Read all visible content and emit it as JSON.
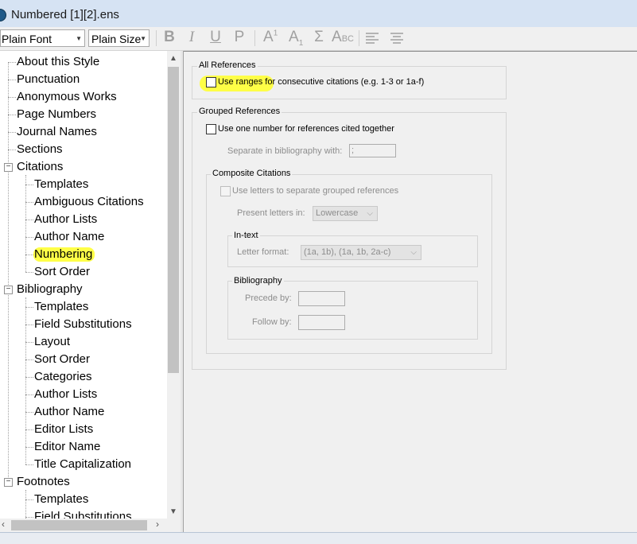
{
  "window": {
    "title": "Numbered [1][2].ens"
  },
  "toolbar": {
    "font": "Plain Font",
    "size": "Plain Size",
    "format_buttons": [
      "B",
      "I",
      "U",
      "P"
    ],
    "script_buttons": [
      "A",
      "A",
      "Σ",
      "A"
    ]
  },
  "tree": {
    "items": [
      "About this Style",
      "Punctuation",
      "Anonymous Works",
      "Page Numbers",
      "Journal Names",
      "Sections",
      "Citations",
      "Templates",
      "Ambiguous Citations",
      "Author Lists",
      "Author Name",
      "Numbering",
      "Sort Order",
      "Bibliography",
      "Templates",
      "Field Substitutions",
      "Layout",
      "Sort Order",
      "Categories",
      "Author Lists",
      "Author Name",
      "Editor Lists",
      "Editor Name",
      "Title Capitalization",
      "Footnotes",
      "Templates",
      "Field Substitutions"
    ],
    "selected": "Numbering"
  },
  "panel": {
    "all_refs": {
      "title": "All References",
      "use_ranges": "Use ranges for consecutive citations (e.g. 1-3 or 1a-f)"
    },
    "grouped": {
      "title": "Grouped References",
      "use_one_number": "Use one number for references cited together",
      "separate_label": "Separate in bibliography with:",
      "separate_value": ";"
    },
    "composite": {
      "title": "Composite Citations",
      "use_letters": "Use letters to separate grouped references",
      "present_label": "Present letters in:",
      "present_value": "Lowercase"
    },
    "intext": {
      "title": "In-text",
      "format_label": "Letter format:",
      "format_value": "(1a, 1b), (1a, 1b, 2a-c)"
    },
    "bibliography": {
      "title": "Bibliography",
      "precede_label": "Precede by:",
      "follow_label": "Follow by:"
    }
  },
  "colors": {
    "highlight": "#ffff33"
  }
}
